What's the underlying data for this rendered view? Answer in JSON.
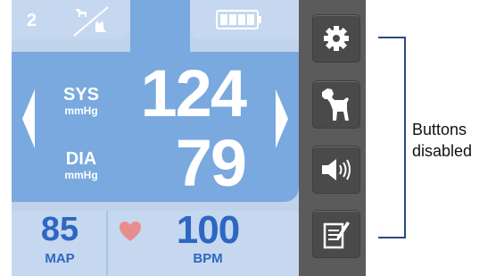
{
  "profile": {
    "number": "2",
    "icon": "dog-cat-icon"
  },
  "battery": {
    "icon": "battery-icon",
    "level_fraction": 1.0
  },
  "reading": {
    "systolic": {
      "label": "SYS",
      "unit": "mmHg",
      "value": "124"
    },
    "diastolic": {
      "label": "DIA",
      "unit": "mmHg",
      "value": "79"
    }
  },
  "nav": {
    "left_icon": "arrow-left-icon",
    "right_icon": "arrow-right-icon"
  },
  "footer": {
    "map": {
      "value": "85",
      "label": "MAP"
    },
    "pulse": {
      "icon": "heart-icon",
      "value": "100",
      "label": "BPM"
    }
  },
  "sidebar": {
    "buttons": [
      {
        "icon": "gear-icon",
        "name": "settings-button"
      },
      {
        "icon": "dog-icon",
        "name": "pet-button"
      },
      {
        "icon": "speaker-icon",
        "name": "sound-button"
      },
      {
        "icon": "notes-icon",
        "name": "notes-button"
      }
    ]
  },
  "annotation": {
    "line1": "Buttons",
    "line2": "disabled"
  },
  "colors": {
    "screen_bg": "#bfd3ea",
    "main_panel": "#79a9de",
    "accent_text": "#2e67c2",
    "sidebar": "#5b5b5b",
    "heart": "#e88d8d"
  }
}
